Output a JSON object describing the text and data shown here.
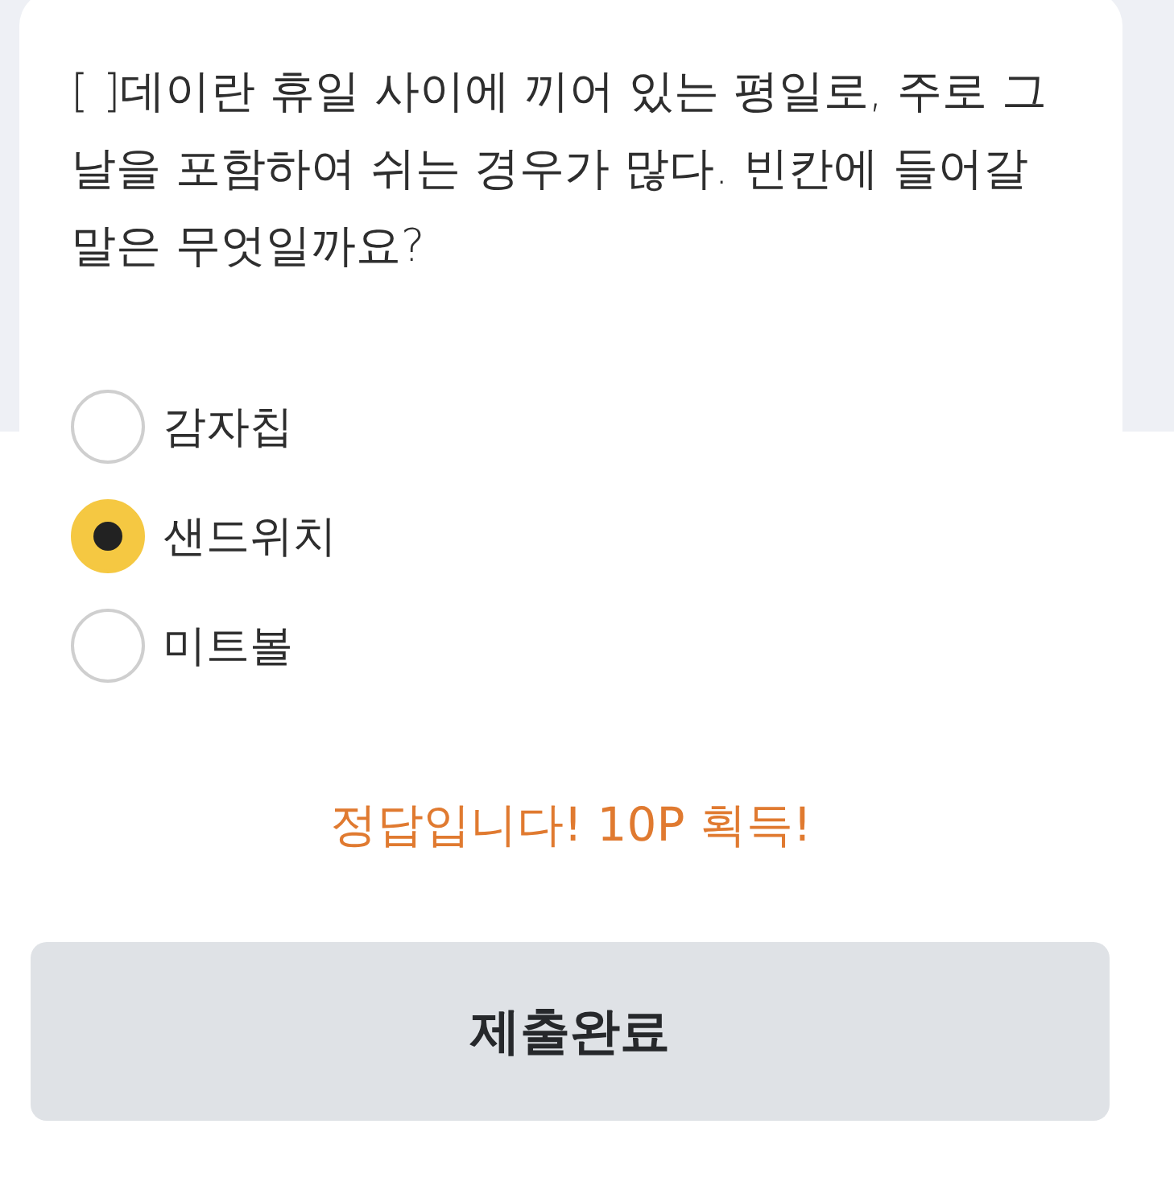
{
  "question": {
    "text": "[ ]데이란 휴일 사이에 끼어 있는 평일로, 주로 그 날을 포함하여 쉬는 경우가 많다. 빈칸에 들어갈 말은 무엇일까요?"
  },
  "options": [
    {
      "label": "감자칩",
      "selected": false
    },
    {
      "label": "샌드위치",
      "selected": true
    },
    {
      "label": "미트볼",
      "selected": false
    }
  ],
  "result": {
    "text": "정답입니다! 10P 획득!"
  },
  "submit_button": {
    "label": "제출완료",
    "disabled": true
  }
}
